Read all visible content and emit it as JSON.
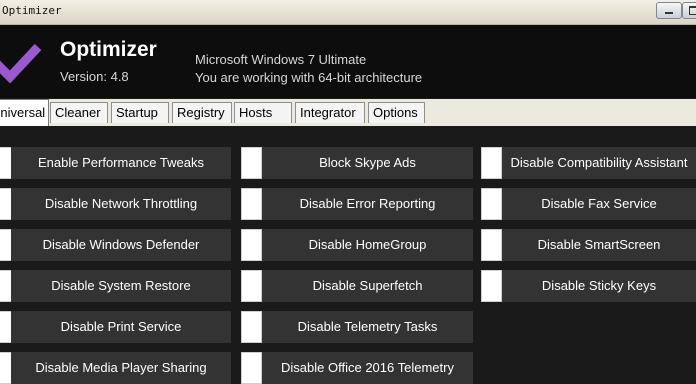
{
  "window": {
    "title": "Optimizer"
  },
  "header": {
    "app_name": "Optimizer",
    "version": "Version: 4.8",
    "os": "Microsoft Windows 7 Ultimate",
    "architecture": "You are working with 64-bit architecture",
    "accent_color": "#9b59d0"
  },
  "tabs": [
    {
      "label": "Universal",
      "active": true
    },
    {
      "label": "Cleaner"
    },
    {
      "label": "Startup"
    },
    {
      "label": "Registry"
    },
    {
      "label": "Hosts"
    },
    {
      "label": "Integrator"
    },
    {
      "label": "Options"
    }
  ],
  "tweaks": {
    "col1": [
      "Enable Performance Tweaks",
      "Disable Network Throttling",
      "Disable Windows Defender",
      "Disable System Restore",
      "Disable Print Service",
      "Disable Media Player Sharing"
    ],
    "col2": [
      "Block Skype Ads",
      "Disable Error Reporting",
      "Disable HomeGroup",
      "Disable Superfetch",
      "Disable Telemetry Tasks",
      "Disable Office 2016 Telemetry"
    ],
    "col3": [
      "Disable Compatibility Assistant",
      "Disable Fax Service",
      "Disable SmartScreen",
      "Disable Sticky Keys"
    ]
  }
}
